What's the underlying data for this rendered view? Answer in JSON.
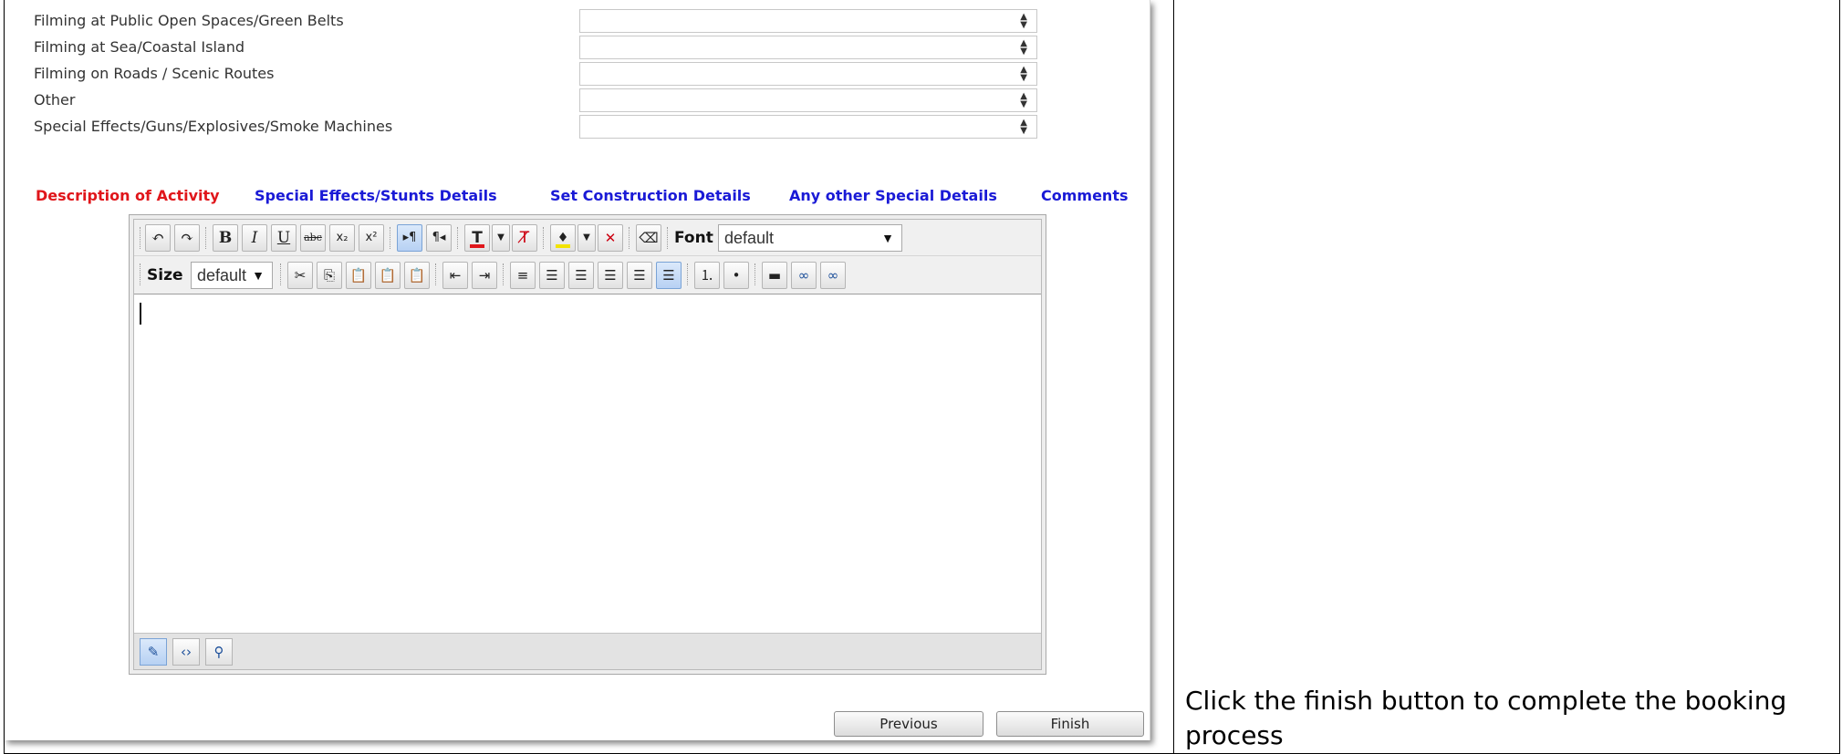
{
  "form_rows": [
    {
      "label": "Filming at Public Open Spaces/Green Belts",
      "value": ""
    },
    {
      "label": "Filming at Sea/Coastal Island",
      "value": ""
    },
    {
      "label": "Filming on Roads / Scenic Routes",
      "value": ""
    },
    {
      "label": "Other",
      "value": ""
    },
    {
      "label": "Special Effects/Guns/Explosives/Smoke Machines",
      "value": ""
    }
  ],
  "tabs": [
    {
      "label": "Description of Activity",
      "active": true
    },
    {
      "label": "Special Effects/Stunts Details",
      "active": false
    },
    {
      "label": "Set Construction Details",
      "active": false
    },
    {
      "label": "Any other Special Details",
      "active": false
    },
    {
      "label": "Comments",
      "active": false
    }
  ],
  "editor": {
    "font_label": "Font",
    "font_value": "default",
    "size_label": "Size",
    "size_value": "default",
    "content": ""
  },
  "buttons": {
    "previous": "Previous",
    "finish": "Finish"
  },
  "instruction": "Click the finish button to complete the booking process",
  "colors": {
    "active_tab": "#e0161b",
    "tab": "#1a1ad6"
  }
}
